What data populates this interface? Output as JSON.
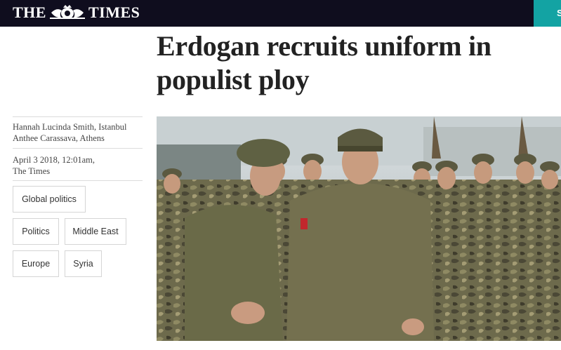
{
  "masthead": {
    "logo_left": "THE",
    "logo_right": "TIMES",
    "subscribe_label": "S"
  },
  "article": {
    "headline": "Erdogan recruits uniform in populist ploy",
    "authors": [
      "Hannah Lucinda Smith, Istanbul",
      "Anthee Carassava, Athens"
    ],
    "date": "April 3 2018, 12:01am,",
    "publication": "The Times",
    "tags": [
      "Global politics",
      "Politics",
      "Middle East",
      "Europe",
      "Syria"
    ]
  },
  "colors": {
    "masthead_bg": "#0f0d1e",
    "accent": "#13a3a3",
    "headline": "#222222"
  }
}
